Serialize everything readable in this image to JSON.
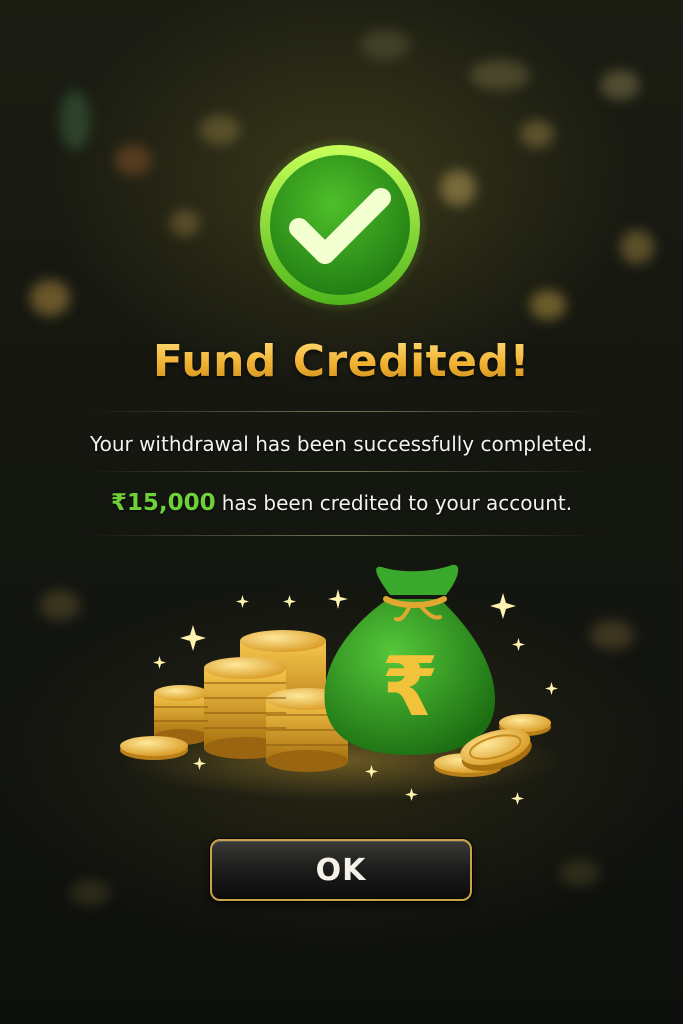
{
  "dialog": {
    "title": "Fund Credited!",
    "message": "Your withdrawal has been successfully completed.",
    "amount": "₹15,000",
    "amount_suffix": "has been credited to your account.",
    "ok_label": "OK"
  },
  "icons": {
    "status": "check-circle-icon",
    "currency_symbol": "₹",
    "illustration": "money-bag-with-coins"
  },
  "colors": {
    "success_green": "#5cc82a",
    "title_gold": "#f2b632",
    "amount_green": "#6fd13a",
    "button_border": "#c9a24a"
  }
}
